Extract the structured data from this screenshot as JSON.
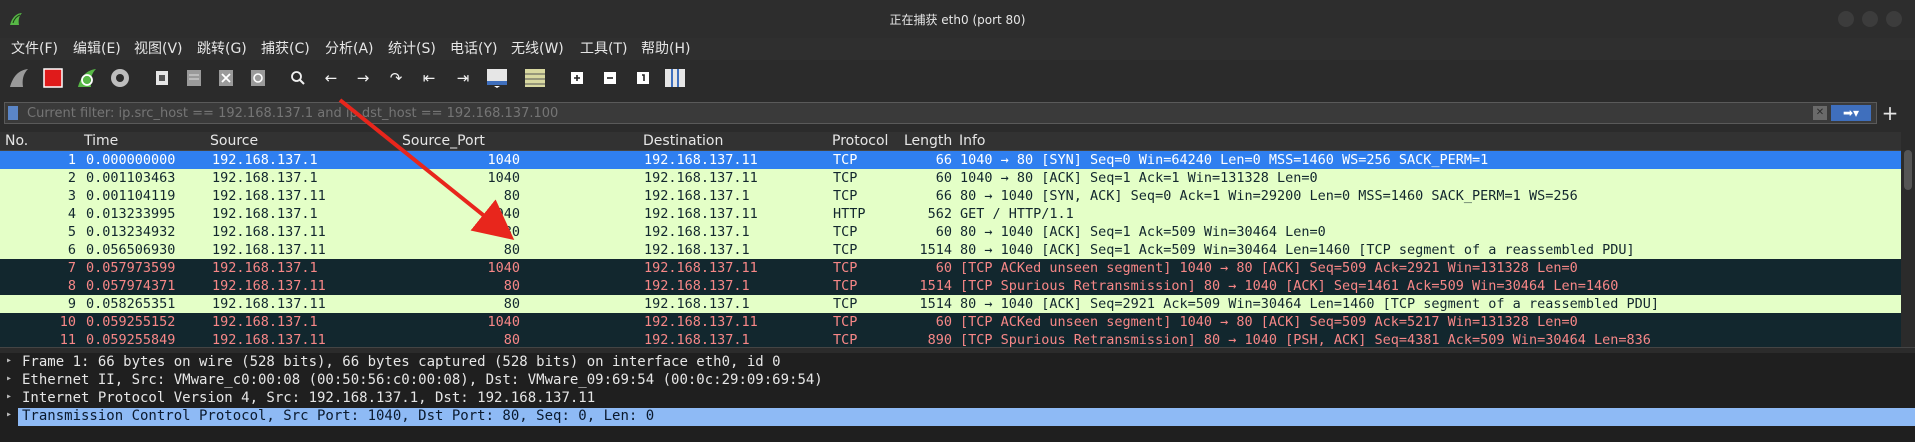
{
  "window": {
    "title": "正在捕获 eth0 (port 80)"
  },
  "menu": [
    "文件(F)",
    "编辑(E)",
    "视图(V)",
    "跳转(G)",
    "捕获(C)",
    "分析(A)",
    "统计(S)",
    "电话(Y)",
    "无线(W)",
    "工具(T)",
    "帮助(H)"
  ],
  "filter": {
    "placeholder": "Current filter: ip.src_host == 192.168.137.1 and ip.dst_host == 192.168.137.100"
  },
  "columns": {
    "no": "No.",
    "time": "Time",
    "source": "Source",
    "source_port": "Source_Port",
    "destination": "Destination",
    "protocol": "Protocol",
    "length": "Length",
    "info": "Info"
  },
  "packets": [
    {
      "no": "1",
      "time": "0.000000000",
      "src": "192.168.137.1",
      "sport": "1040",
      "dst": "192.168.137.11",
      "proto": "TCP",
      "len": "66",
      "info": "1040 → 80 [SYN] Seq=0 Win=64240 Len=0 MSS=1460 WS=256 SACK_PERM=1",
      "style": "sel"
    },
    {
      "no": "2",
      "time": "0.001103463",
      "src": "192.168.137.1",
      "sport": "1040",
      "dst": "192.168.137.11",
      "proto": "TCP",
      "len": "60",
      "info": "1040 → 80 [ACK] Seq=1 Ack=1 Win=131328 Len=0",
      "style": "green"
    },
    {
      "no": "3",
      "time": "0.001104119",
      "src": "192.168.137.11",
      "sport": "80",
      "dst": "192.168.137.1",
      "proto": "TCP",
      "len": "66",
      "info": "80 → 1040 [SYN, ACK] Seq=0 Ack=1 Win=29200 Len=0 MSS=1460 SACK_PERM=1 WS=256",
      "style": "green"
    },
    {
      "no": "4",
      "time": "0.013233995",
      "src": "192.168.137.1",
      "sport": "1040",
      "dst": "192.168.137.11",
      "proto": "HTTP",
      "len": "562",
      "info": "GET / HTTP/1.1",
      "style": "green"
    },
    {
      "no": "5",
      "time": "0.013234932",
      "src": "192.168.137.11",
      "sport": "80",
      "dst": "192.168.137.1",
      "proto": "TCP",
      "len": "60",
      "info": "80 → 1040 [ACK] Seq=1 Ack=509 Win=30464 Len=0",
      "style": "green"
    },
    {
      "no": "6",
      "time": "0.056506930",
      "src": "192.168.137.11",
      "sport": "80",
      "dst": "192.168.137.1",
      "proto": "TCP",
      "len": "1514",
      "info": "80 → 1040 [ACK] Seq=1 Ack=509 Win=30464 Len=1460 [TCP segment of a reassembled PDU]",
      "style": "green"
    },
    {
      "no": "7",
      "time": "0.057973599",
      "src": "192.168.137.1",
      "sport": "1040",
      "dst": "192.168.137.11",
      "proto": "TCP",
      "len": "60",
      "info": "[TCP ACKed unseen segment] 1040 → 80 [ACK] Seq=509 Ack=2921 Win=131328 Len=0",
      "style": "dark"
    },
    {
      "no": "8",
      "time": "0.057974371",
      "src": "192.168.137.11",
      "sport": "80",
      "dst": "192.168.137.1",
      "proto": "TCP",
      "len": "1514",
      "info": "[TCP Spurious Retransmission] 80 → 1040 [ACK] Seq=1461 Ack=509 Win=30464 Len=1460",
      "style": "dark"
    },
    {
      "no": "9",
      "time": "0.058265351",
      "src": "192.168.137.11",
      "sport": "80",
      "dst": "192.168.137.1",
      "proto": "TCP",
      "len": "1514",
      "info": "80 → 1040 [ACK] Seq=2921 Ack=509 Win=30464 Len=1460 [TCP segment of a reassembled PDU]",
      "style": "green"
    },
    {
      "no": "10",
      "time": "0.059255152",
      "src": "192.168.137.1",
      "sport": "1040",
      "dst": "192.168.137.11",
      "proto": "TCP",
      "len": "60",
      "info": "[TCP ACKed unseen segment] 1040 → 80 [ACK] Seq=509 Ack=5217 Win=131328 Len=0",
      "style": "dark"
    },
    {
      "no": "11",
      "time": "0.059255849",
      "src": "192.168.137.11",
      "sport": "80",
      "dst": "192.168.137.1",
      "proto": "TCP",
      "len": "890",
      "info": "[TCP Spurious Retransmission] 80 → 1040 [PSH, ACK] Seq=4381 Ack=509 Win=30464 Len=836",
      "style": "dark"
    }
  ],
  "details": [
    {
      "text": "Frame 1: 66 bytes on wire (528 bits), 66 bytes captured (528 bits) on interface eth0, id 0"
    },
    {
      "text": "Ethernet II, Src: VMware_c0:00:08 (00:50:56:c0:00:08), Dst: VMware_09:69:54 (00:0c:29:09:69:54)"
    },
    {
      "text": "Internet Protocol Version 4, Src: 192.168.137.1, Dst: 192.168.137.11"
    },
    {
      "text": "Transmission Control Protocol, Src Port: 1040, Dst Port: 80, Seq: 0, Len: 0"
    }
  ],
  "colors": {
    "selected_row": "#2f7ff0",
    "green_row": "#e4ffc7",
    "dark_row": "#12272e",
    "dark_row_text": "#f78787",
    "annotation_arrow": "#e8261c"
  }
}
